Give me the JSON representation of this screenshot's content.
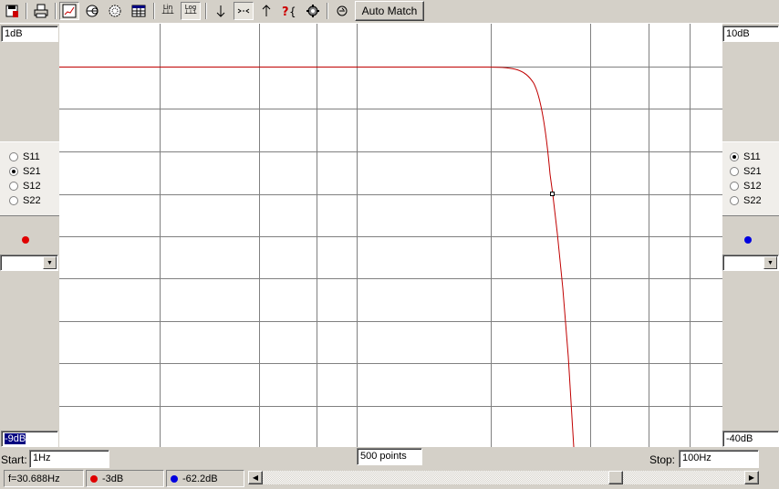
{
  "toolbar": {
    "lin_label": "Lin",
    "log_label": "Log",
    "auto_match_label": "Auto Match"
  },
  "left_panel": {
    "top_scale": "1dB",
    "bottom_scale": "-9dB",
    "params": [
      "S11",
      "S21",
      "S12",
      "S22"
    ],
    "selected": "S21",
    "marker_color": "#e00000"
  },
  "right_panel": {
    "top_scale": "10dB",
    "bottom_scale": "-40dB",
    "params": [
      "S11",
      "S21",
      "S12",
      "S22"
    ],
    "selected": "S11",
    "marker_color": "#0000e0"
  },
  "sweep": {
    "start_label": "Start:",
    "start_value": "1Hz",
    "points": "500 points",
    "stop_label": "Stop:",
    "stop_value": "100Hz"
  },
  "status": {
    "frequency": "f=30.688Hz",
    "trace1_value": "-3dB",
    "trace2_value": "-62.2dB"
  },
  "plot": {
    "trace_color": "#c00000",
    "marker_fraction": 0.744,
    "scrollbar_position": 0.74
  }
}
